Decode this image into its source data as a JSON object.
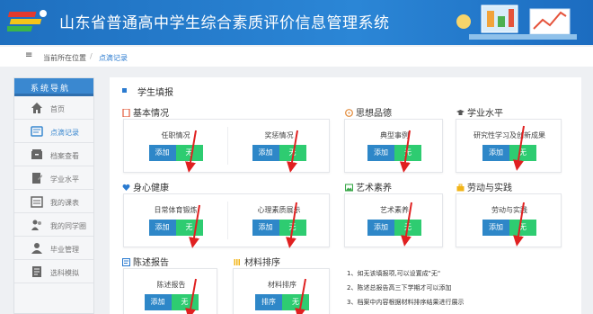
{
  "header": {
    "title": "山东省普通高中学生综合素质评价信息管理系统"
  },
  "breadcrumb": {
    "current_label": "当前所在位置",
    "page": "点滴记录"
  },
  "sidebar": {
    "title": "系统导航",
    "items": [
      {
        "label": "首页",
        "icon": "home-icon"
      },
      {
        "label": "点滴记录",
        "icon": "drops-record-icon",
        "active": true
      },
      {
        "label": "档案查看",
        "icon": "archive-icon"
      },
      {
        "label": "学业水平",
        "icon": "academic-icon"
      },
      {
        "label": "我的课表",
        "icon": "schedule-icon"
      },
      {
        "label": "我的同学圈",
        "icon": "classmates-icon"
      },
      {
        "label": "毕业管理",
        "icon": "graduation-icon"
      },
      {
        "label": "选科模拟",
        "icon": "course-select-icon"
      }
    ]
  },
  "main": {
    "title": "学生填报",
    "add_label": "添加",
    "none_label": "无",
    "sort_label": "排序",
    "sections": {
      "basic": {
        "title": "基本情况",
        "items": [
          "任职情况",
          "奖惩情况"
        ]
      },
      "moral": {
        "title": "思想品德",
        "items": [
          "典型事例"
        ]
      },
      "academic": {
        "title": "学业水平",
        "items": [
          "研究性学习及创新成果"
        ]
      },
      "health": {
        "title": "身心健康",
        "items": [
          "日常体育锻炼",
          "心理素质展示"
        ]
      },
      "art": {
        "title": "艺术素养",
        "items": [
          "艺术素养"
        ]
      },
      "labor": {
        "title": "劳动与实践",
        "items": [
          "劳动与实践"
        ]
      },
      "statement": {
        "title": "陈述报告",
        "items": [
          "陈述报告"
        ]
      },
      "material": {
        "title": "材料排序",
        "items": [
          "材料排序"
        ]
      }
    },
    "notes": [
      "1、如无该填报项,可以设置成\"无\"",
      "2、陈述总报告高三下学期才可以添加",
      "3、档案中内容根据材料排序结果进行展示"
    ]
  },
  "colors": {
    "header_bg": "#2b86d6",
    "add_button": "#2e87c8",
    "none_button": "#2ecc71",
    "arrow": "#e02020",
    "accent": "#3a88d0"
  }
}
